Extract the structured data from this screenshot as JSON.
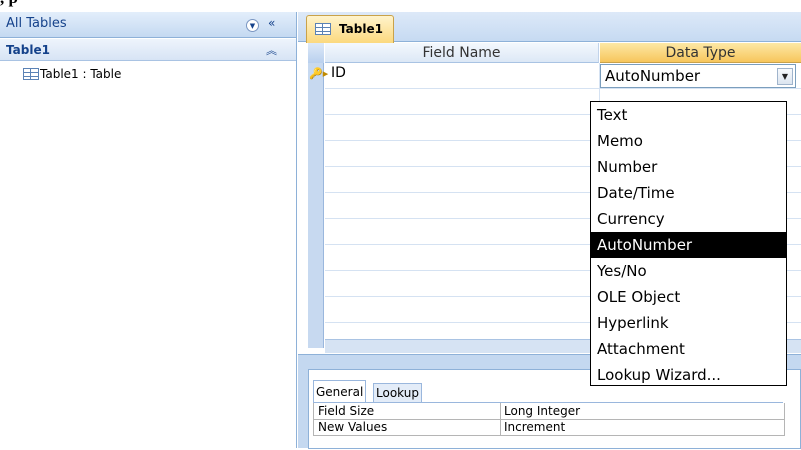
{
  "caption": ", p",
  "nav": {
    "title": "All Tables",
    "group_title": "Table1",
    "items": [
      {
        "label": "Table1 : Table"
      }
    ]
  },
  "tab": {
    "label": "Table1"
  },
  "grid": {
    "header_field": "Field Name",
    "header_type": "Data Type",
    "rows": [
      {
        "field": "ID",
        "type": "AutoNumber"
      }
    ]
  },
  "dropdown": {
    "selected": "AutoNumber",
    "options": [
      "Text",
      "Memo",
      "Number",
      "Date/Time",
      "Currency",
      "AutoNumber",
      "Yes/No",
      "OLE Object",
      "Hyperlink",
      "Attachment",
      "Lookup Wizard..."
    ]
  },
  "properties": {
    "tabs": [
      "General",
      "Lookup"
    ],
    "rows": [
      {
        "name": "Field Size",
        "value": "Long Integer"
      },
      {
        "name": "New Values",
        "value": "Increment"
      }
    ]
  }
}
